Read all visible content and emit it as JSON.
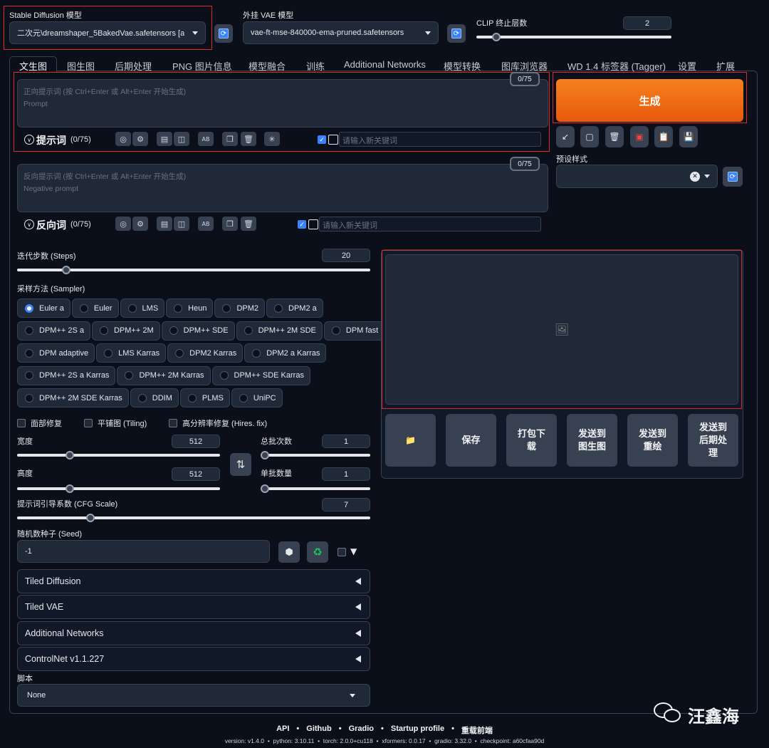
{
  "top": {
    "sd_model_label": "Stable Diffusion 模型",
    "sd_model_value": "二次元\\dreamshaper_5BakedVae.safetensors [a",
    "vae_label": "外挂 VAE 模型",
    "vae_value": "vae-ft-mse-840000-ema-pruned.safetensors",
    "clip_label": "CLIP 终止层数",
    "clip_value": "2",
    "refresh_glyph": "⟳"
  },
  "tabs": [
    "文生图",
    "图生图",
    "后期处理",
    "PNG 图片信息",
    "模型融合",
    "训练",
    "Additional Networks",
    "模型转换",
    "图库浏览器",
    "WD 1.4 标签器 (Tagger)",
    "设置",
    "扩展"
  ],
  "prompt": {
    "placeholder_line1": "正向提示词 (按 Ctrl+Enter 或 Alt+Enter 开始生成)",
    "placeholder_line2": "Prompt",
    "counter": "0/75",
    "title": "提示词",
    "count": "(0/75)",
    "keyword_placeholder": "请输入新关键词"
  },
  "negative": {
    "placeholder_line1": "反向提示词 (按 Ctrl+Enter 或 Alt+Enter 开始生成)",
    "placeholder_line2": "Negative prompt",
    "counter": "0/75",
    "title": "反向词",
    "count": "(0/75)",
    "keyword_placeholder": "请输入新关键词"
  },
  "generate": {
    "label": "生成",
    "tools": [
      "↙",
      "▢",
      "🗑",
      "▣",
      "📋",
      "💾"
    ],
    "style_label": "预设样式"
  },
  "steps": {
    "label": "迭代步数 (Steps)",
    "value": "20",
    "fraction": 0.13
  },
  "sampler": {
    "label": "采样方法 (Sampler)",
    "selected": "Euler a",
    "rows": [
      [
        "Euler a",
        "Euler",
        "LMS",
        "Heun",
        "DPM2",
        "DPM2 a"
      ],
      [
        "DPM++ 2S a",
        "DPM++ 2M",
        "DPM++ SDE",
        "DPM++ 2M SDE",
        "DPM fast"
      ],
      [
        "DPM adaptive",
        "LMS Karras",
        "DPM2 Karras",
        "DPM2 a Karras"
      ],
      [
        "DPM++ 2S a Karras",
        "DPM++ 2M Karras",
        "DPM++ SDE Karras"
      ],
      [
        "DPM++ 2M SDE Karras",
        "DDIM",
        "PLMS",
        "UniPC"
      ]
    ]
  },
  "checks": [
    "面部修复",
    "平铺图 (Tiling)",
    "高分辨率修复 (Hires. fix)"
  ],
  "width": {
    "label": "宽度",
    "value": "512",
    "fraction": 0.25
  },
  "height": {
    "label": "高度",
    "value": "512",
    "fraction": 0.25
  },
  "batch_count": {
    "label": "总批次数",
    "value": "1",
    "fraction": 0.0
  },
  "batch_size": {
    "label": "单批数量",
    "value": "1",
    "fraction": 0.0
  },
  "swap_glyph": "⇅",
  "cfg": {
    "label": "提示词引导系数 (CFG Scale)",
    "value": "7",
    "fraction": 0.2
  },
  "seed": {
    "label": "随机数种子 (Seed)",
    "value": "-1",
    "dice": "⬢",
    "recycle": "♻",
    "extra": "▼"
  },
  "accordions": [
    "Tiled Diffusion",
    "Tiled VAE",
    "Additional Networks",
    "ControlNet v1.1.227"
  ],
  "script": {
    "label": "脚本",
    "value": "None"
  },
  "output": {
    "image_icon": "🖼",
    "buttons": [
      "📁",
      "保存",
      "打包下载",
      "发送到图生图",
      "发送到重绘",
      "发送到后期处理"
    ]
  },
  "footer": {
    "links": [
      "API",
      "Github",
      "Gradio",
      "Startup profile",
      "重载前端"
    ],
    "sep": "•",
    "version_line": "version: v1.4.0  •  python: 3.10.11  •  torch: 2.0.0+cu118  •  xformers: 0.0.17  •  gradio: 3.32.0  •  checkpoint: a60cfaa90d"
  },
  "watermark": "汪鑫海"
}
